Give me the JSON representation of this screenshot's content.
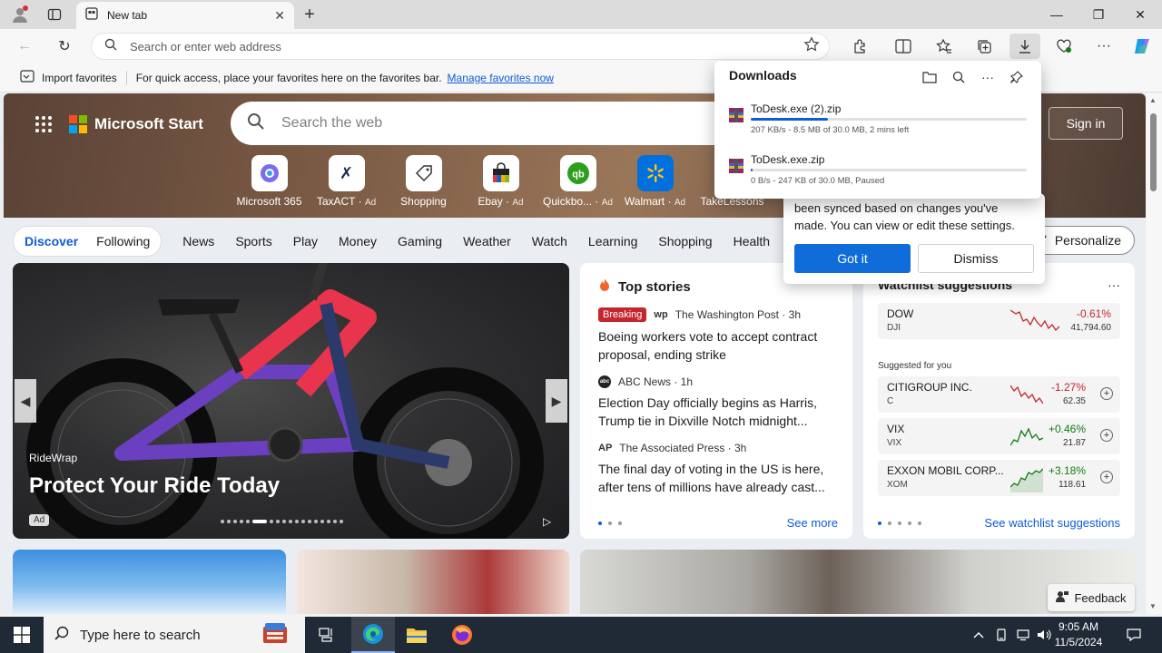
{
  "browser": {
    "tab_title": "New tab",
    "address_placeholder": "Search or enter web address"
  },
  "favorites_bar": {
    "import_label": "Import favorites",
    "message": "For quick access, place your favorites here on the favorites bar.",
    "manage_link": "Manage favorites now"
  },
  "downloads": {
    "title": "Downloads",
    "items": [
      {
        "name": "ToDesk.exe (2).zip",
        "status": "207 KB/s - 8.5 MB of 30.0 MB, 2 mins left",
        "progress": 0.28
      },
      {
        "name": "ToDesk.exe.zip",
        "status": "0 B/s - 247 KB of 30.0 MB, Paused",
        "progress": 0.008
      }
    ]
  },
  "sync_tip": {
    "text": "been synced based on changes you've made. You can view or edit these settings.",
    "primary": "Got it",
    "secondary": "Dismiss"
  },
  "start_page": {
    "brand": "Microsoft Start",
    "search_placeholder": "Search the web",
    "sign_in": "Sign in",
    "quick_links": [
      {
        "label": "Microsoft 365",
        "ad": ""
      },
      {
        "label": "TaxACT",
        "ad": "Ad"
      },
      {
        "label": "Shopping",
        "ad": ""
      },
      {
        "label": "Ebay",
        "ad": "Ad"
      },
      {
        "label": "Quickbo...",
        "ad": "Ad"
      },
      {
        "label": "Walmart",
        "ad": "Ad"
      },
      {
        "label": "TakeLessons",
        "ad": ""
      }
    ],
    "nav": {
      "discover": "Discover",
      "following": "Following",
      "links": [
        "News",
        "Sports",
        "Play",
        "Money",
        "Gaming",
        "Weather",
        "Watch",
        "Learning",
        "Shopping",
        "Health"
      ],
      "personalize": "Personalize"
    },
    "hero": {
      "source": "RideWrap",
      "title": "Protect Your Ride Today",
      "ad": "Ad"
    },
    "top_stories": {
      "title": "Top stories",
      "items": [
        {
          "badge": "Breaking",
          "logo": "wp",
          "source": "The Washington Post · 3h",
          "headline": "Boeing workers vote to accept contract proposal, ending strike"
        },
        {
          "badge": "",
          "logo": "abc",
          "source": "ABC News · 1h",
          "headline": "Election Day officially begins as Harris, Trump tie in Dixville Notch midnight..."
        },
        {
          "badge": "",
          "logo": "AP",
          "source": "The Associated Press · 3h",
          "headline": "The final day of voting in the US is here, after tens of millions have already cast..."
        }
      ],
      "see_more": "See more"
    },
    "watchlist": {
      "title": "Watchlist suggestions",
      "featured": {
        "name": "DOW",
        "ticker": "DJI",
        "change": "-0.61%",
        "price": "41,794.60",
        "direction": "down"
      },
      "suggested_label": "Suggested for you",
      "suggested": [
        {
          "name": "CITIGROUP INC.",
          "ticker": "C",
          "change": "-1.27%",
          "price": "62.35",
          "direction": "down"
        },
        {
          "name": "VIX",
          "ticker": "VIX",
          "change": "+0.46%",
          "price": "21.87",
          "direction": "up"
        },
        {
          "name": "EXXON MOBIL CORP...",
          "ticker": "XOM",
          "change": "+3.18%",
          "price": "118.61",
          "direction": "up"
        }
      ],
      "see_link": "See watchlist suggestions"
    },
    "feedback": "Feedback"
  },
  "taskbar": {
    "search_placeholder": "Type here to search",
    "time": "9:05 AM",
    "date": "11/5/2024"
  },
  "colors": {
    "accent": "#0f5bd8",
    "breaking": "#c4262e",
    "negative": "#c4262e",
    "positive": "#107c10"
  }
}
